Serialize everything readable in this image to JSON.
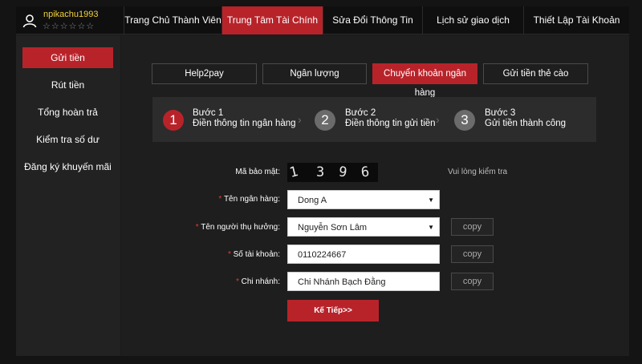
{
  "user": {
    "username": "npikachu1993",
    "stars": "☆☆☆☆☆☆",
    "icon": "user-icon"
  },
  "nav": [
    {
      "label": "Trang Chủ Thành Viên",
      "active": false
    },
    {
      "label": "Trung Tâm Tài Chính",
      "active": true
    },
    {
      "label": "Sửa Đổi Thông Tin",
      "active": false
    },
    {
      "label": "Lịch sử giao dịch",
      "active": false
    },
    {
      "label": "Thiết Lập Tài Khoản",
      "active": false
    }
  ],
  "sidebar": [
    {
      "label": "Gửi tiền",
      "active": true
    },
    {
      "label": "Rút tiền",
      "active": false
    },
    {
      "label": "Tổng hoàn trả",
      "active": false
    },
    {
      "label": "Kiểm tra số dư",
      "active": false
    },
    {
      "label": "Đăng ký khuyến mãi",
      "active": false
    }
  ],
  "tabs": [
    {
      "label": "Help2pay",
      "active": false
    },
    {
      "label": "Ngân lượng",
      "active": false
    },
    {
      "label": "Chuyển khoản ngân hàng",
      "active": true
    },
    {
      "label": "Gửi tiền thẻ cào",
      "active": false
    }
  ],
  "steps": [
    {
      "num": "1",
      "title": "Bước 1",
      "desc": "Điền thông tin ngân hàng",
      "active": true
    },
    {
      "num": "2",
      "title": "Bước 2",
      "desc": "Điền thông tin gửi tiền",
      "active": false
    },
    {
      "num": "3",
      "title": "Bước 3",
      "desc": "Gửi tiền thành công",
      "active": false
    }
  ],
  "form": {
    "captcha_label": "Mã bảo mật:",
    "captcha_chars": [
      "1",
      "3",
      "9",
      "6"
    ],
    "captcha_hint": "Vui lòng kiểm tra",
    "bank_label": "Tên ngân hàng:",
    "bank_value": "Dong A",
    "beneficiary_label": "Tên người thụ hưởng:",
    "beneficiary_value": "Nguyễn Sơn Lâm",
    "account_label": "Số tài khoản:",
    "account_value": "0110224667",
    "branch_label": "Chi nhánh:",
    "branch_value": "Chi Nhánh Bạch Đằng",
    "required_mark": "*",
    "copy_label": "copy",
    "dropdown_arrow": "▼",
    "next_label": "Kế Tiếp>>"
  },
  "colors": {
    "accent": "#b8232a",
    "username": "#f2d13b",
    "background": "#1b1b1b"
  }
}
